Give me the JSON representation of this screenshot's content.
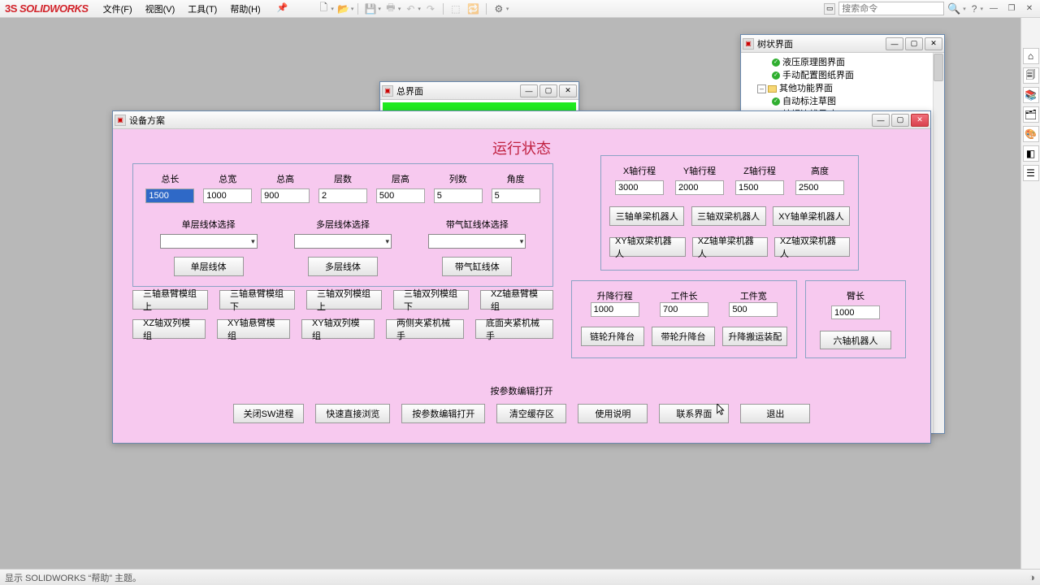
{
  "app": {
    "brand": "SOLIDWORKS"
  },
  "menu": [
    "文件(F)",
    "视图(V)",
    "工具(T)",
    "帮助(H)"
  ],
  "search": {
    "placeholder": "搜索命令"
  },
  "treewin": {
    "title": "树状界面",
    "items": [
      {
        "indent": 36,
        "check": true,
        "label": "液压原理图界面"
      },
      {
        "indent": 36,
        "check": true,
        "label": "手动配置图纸界面"
      },
      {
        "indent": 22,
        "node": "-",
        "folder": true,
        "label": "其他功能界面"
      },
      {
        "indent": 36,
        "check": true,
        "label": "自动标注草图"
      },
      {
        "indent": 36,
        "check": true,
        "label": "编辑边线尺寸"
      }
    ]
  },
  "zjm": {
    "title": "总界面"
  },
  "dlg": {
    "title": "设备方案",
    "heading": "运行状态",
    "dims": {
      "labels": [
        "总长",
        "总宽",
        "总高",
        "层数",
        "层高",
        "列数",
        "角度"
      ],
      "values": [
        "1500",
        "1000",
        "900",
        "2",
        "500",
        "5",
        "5"
      ]
    },
    "selects": {
      "labels": [
        "单层线体选择",
        "多层线体选择",
        "带气缸线体选择"
      ],
      "btns": [
        "单层线体",
        "多层线体",
        "带气缸线体"
      ]
    },
    "leftbtns1": [
      "三轴悬臂模组上",
      "三轴悬臂模组下",
      "三轴双列模组上",
      "三轴双列模组下",
      "XZ轴悬臂模组"
    ],
    "leftbtns2": [
      "XZ轴双列模组",
      "XY轴悬臂模组",
      "XY轴双列模组",
      "两侧夹紧机械手",
      "底面夹紧机械手"
    ],
    "axes": {
      "labels": [
        "X轴行程",
        "Y轴行程",
        "Z轴行程",
        "高度"
      ],
      "values": [
        "3000",
        "2000",
        "1500",
        "2500"
      ]
    },
    "robotbtns1": [
      "三轴单梁机器人",
      "三轴双梁机器人",
      "XY轴单梁机器人"
    ],
    "robotbtns2": [
      "XY轴双梁机器人",
      "XZ轴单梁机器人",
      "XZ轴双梁机器人"
    ],
    "lift": {
      "labels": [
        "升降行程",
        "工件长",
        "工件宽"
      ],
      "values": [
        "1000",
        "700",
        "500"
      ],
      "btns": [
        "链轮升降台",
        "带轮升降台",
        "升降搬运装配"
      ]
    },
    "arm": {
      "label": "臂长",
      "value": "1000",
      "btn": "六轴机器人"
    },
    "bottomlabel": "按参数编辑打开",
    "bottombtns": [
      "关闭SW进程",
      "快速直接浏览",
      "按参数编辑打开",
      "清空缓存区",
      "使用说明",
      "联系界面",
      "退出"
    ]
  },
  "status": {
    "text": "显示 SOLIDWORKS “帮助” 主题。"
  }
}
